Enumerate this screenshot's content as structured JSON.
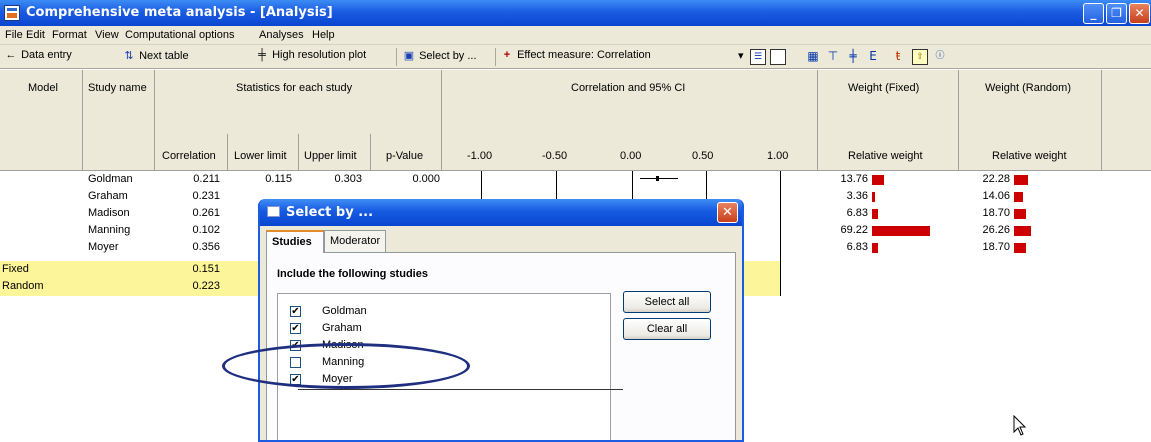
{
  "window": {
    "title": "Comprehensive meta analysis - [Analysis]"
  },
  "menu": [
    "File",
    "Edit",
    "Format",
    "View",
    "Computational options",
    "Analyses",
    "Help"
  ],
  "toolbar": {
    "data_entry": "Data entry",
    "next_table": "Next table",
    "high_res": "High resolution plot",
    "select_by": "Select by ...",
    "effect_measure": "Effect measure: Correlation"
  },
  "grid": {
    "headers": {
      "model": "Model",
      "study_name": "Study name",
      "statistics": "Statistics for each study",
      "forest": "Correlation and 95% CI",
      "weight_fixed": "Weight (Fixed)",
      "weight_random": "Weight (Random)",
      "correlation": "Correlation",
      "lower": "Lower limit",
      "upper": "Upper limit",
      "pvalue": "p-Value",
      "axis": [
        "-1.00",
        "-0.50",
        "0.00",
        "0.50",
        "1.00"
      ],
      "relative_weight": "Relative weight"
    },
    "rows": [
      {
        "study": "Goldman",
        "corr": "0.211",
        "lower": "0.115",
        "upper": "0.303",
        "p": "0.000",
        "wf": "13.76",
        "wr": "22.28",
        "wf_val": 13.76,
        "wr_val": 22.28
      },
      {
        "study": "Graham",
        "corr": "0.231",
        "lower": "",
        "upper": "",
        "p": "",
        "wf": "3.36",
        "wr": "14.06",
        "wf_val": 3.36,
        "wr_val": 14.06
      },
      {
        "study": "Madison",
        "corr": "0.261",
        "lower": "",
        "upper": "",
        "p": "",
        "wf": "6.83",
        "wr": "18.70",
        "wf_val": 6.83,
        "wr_val": 18.7
      },
      {
        "study": "Manning",
        "corr": "0.102",
        "lower": "",
        "upper": "",
        "p": "",
        "wf": "69.22",
        "wr": "26.26",
        "wf_val": 69.22,
        "wr_val": 26.26
      },
      {
        "study": "Moyer",
        "corr": "0.356",
        "lower": "",
        "upper": "",
        "p": "",
        "wf": "6.83",
        "wr": "18.70",
        "wf_val": 6.83,
        "wr_val": 18.7
      }
    ],
    "summary": [
      {
        "model": "Fixed",
        "corr": "0.151"
      },
      {
        "model": "Random",
        "corr": "0.223"
      }
    ],
    "bar_color": "#cc0000",
    "summary_color": "#fdf59a"
  },
  "dialog": {
    "title": "Select by ...",
    "tabs": [
      "Studies",
      "Moderator"
    ],
    "include_label": "Include the following studies",
    "studies": [
      {
        "name": "Goldman",
        "checked": true
      },
      {
        "name": "Graham",
        "checked": true
      },
      {
        "name": "Madison",
        "checked": true
      },
      {
        "name": "Manning",
        "checked": false
      },
      {
        "name": "Moyer",
        "checked": true
      }
    ],
    "select_all": "Select all",
    "clear_all": "Clear all"
  },
  "annotation": {
    "highlight_color": "#1f2f80"
  }
}
